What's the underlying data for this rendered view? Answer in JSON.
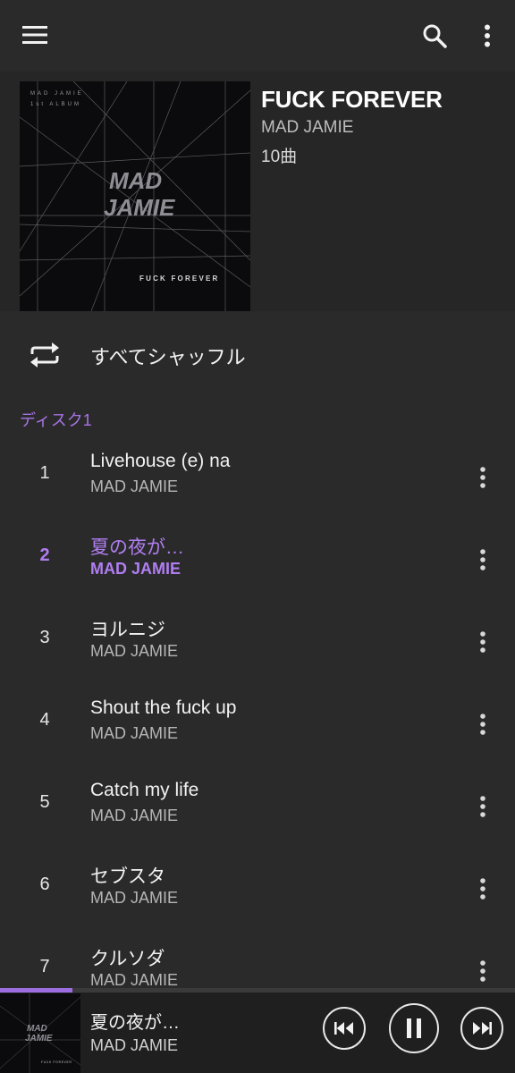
{
  "topbar": {
    "menu_icon": "menu-icon",
    "search_icon": "search-icon",
    "more_icon": "more-vert-icon"
  },
  "album": {
    "title": "FUCK FOREVER",
    "artist": "MAD JAMIE",
    "track_count": "10曲",
    "cover": {
      "top_line1": "MAD JAMIE",
      "top_line2": "1st ALBUM",
      "logo_line1": "MAD",
      "logo_line2": "JAMIE",
      "bottom_text": "FUCK FOREVER"
    }
  },
  "shuffle": {
    "label": "すべてシャッフル",
    "icon": "shuffle-repeat-icon"
  },
  "disc": {
    "label": "ディスク1"
  },
  "tracks": [
    {
      "number": "1",
      "title": "Livehouse (e) na",
      "artist": "MAD JAMIE"
    },
    {
      "number": "2",
      "title": "夏の夜が…",
      "artist": "MAD JAMIE",
      "active": true
    },
    {
      "number": "3",
      "title": "ヨルニジ",
      "artist": "MAD JAMIE"
    },
    {
      "number": "4",
      "title": "Shout the fuck up",
      "artist": "MAD JAMIE"
    },
    {
      "number": "5",
      "title": "Catch my life",
      "artist": "MAD JAMIE"
    },
    {
      "number": "6",
      "title": "セブスタ",
      "artist": "MAD JAMIE"
    },
    {
      "number": "7",
      "title": "クルソダ",
      "artist": "MAD JAMIE"
    }
  ],
  "player": {
    "title": "夏の夜が…",
    "artist": "MAD JAMIE",
    "progress": 0.14,
    "controls": [
      "previous-icon",
      "pause-icon",
      "next-icon"
    ]
  },
  "colors": {
    "background": "#2a2a2b",
    "accent": "#a874e6"
  }
}
